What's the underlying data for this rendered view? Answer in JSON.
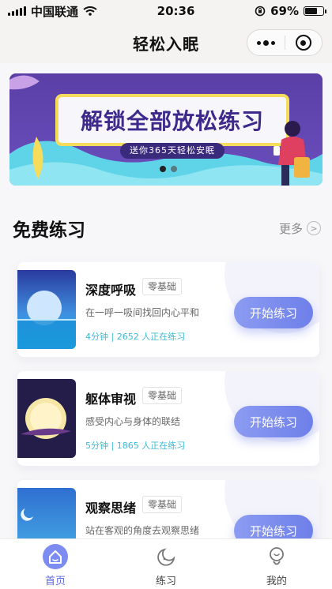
{
  "status_bar": {
    "carrier": "中国联通",
    "time": "20:36",
    "battery": "69%",
    "battery_level": 0.69
  },
  "nav": {
    "title": "轻松入眠"
  },
  "banner": {
    "title": "解锁全部放松练习",
    "subtitle": "送你365天轻松安眠",
    "accent_color": "#5b3fa7"
  },
  "section": {
    "title": "免费练习",
    "more_label": "更多"
  },
  "cards": [
    {
      "title": "深度呼吸",
      "tag": "零基础",
      "desc": "在一呼一吸间找回内心平和",
      "meta": "4分钟 | 2652 人正在练习",
      "button": "开始练习"
    },
    {
      "title": "躯体审视",
      "tag": "零基础",
      "desc": "感受内心与身体的联结",
      "meta": "5分钟 | 1865 人正在练习",
      "button": "开始练习"
    },
    {
      "title": "观察思绪",
      "tag": "零基础",
      "desc": "站在客观的角度去观察思绪",
      "meta": "",
      "button": "开始练习"
    }
  ],
  "tabs": [
    {
      "label": "首页",
      "icon": "home-icon",
      "active": true
    },
    {
      "label": "练习",
      "icon": "practice-icon",
      "active": false
    },
    {
      "label": "我的",
      "icon": "profile-icon",
      "active": false
    }
  ],
  "colors": {
    "primary": "#6e7fe9",
    "meta_text": "#3dbbd7"
  }
}
